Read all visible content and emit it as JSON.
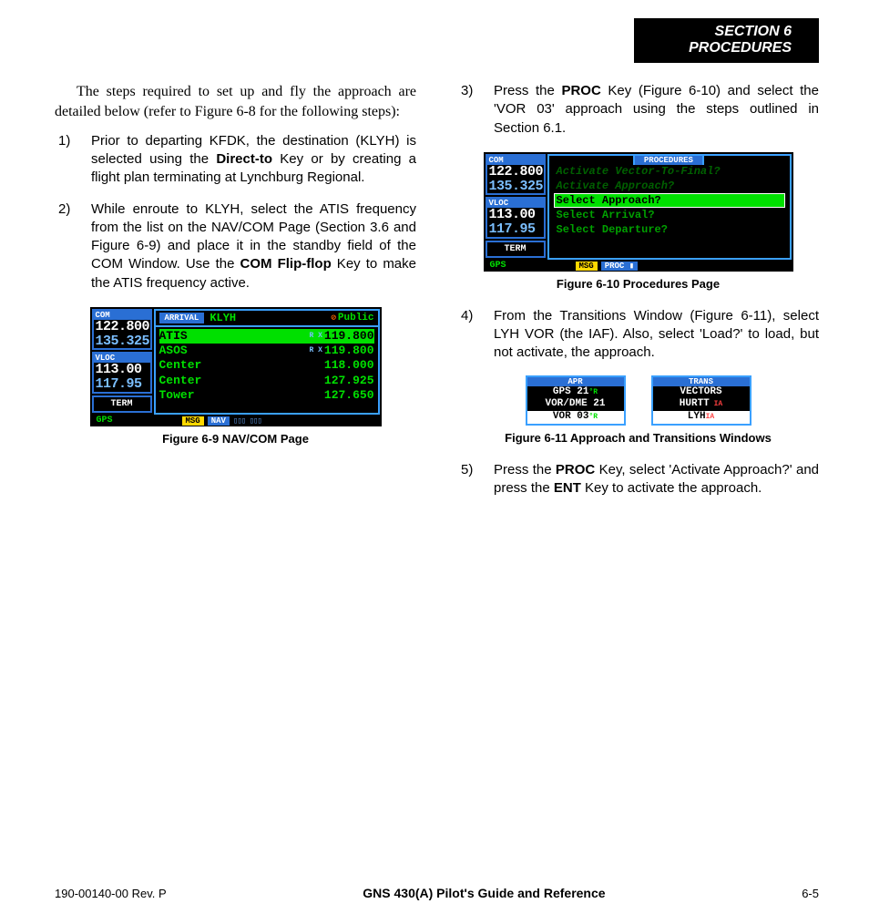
{
  "header": {
    "line1": "SECTION 6",
    "line2": "PROCEDURES"
  },
  "intro": "The steps required to set up and fly the approach are detailed below (refer to Figure 6-8 for the following steps):",
  "steps": {
    "s1": {
      "num": "1)",
      "pre": "Prior to departing KFDK, the destination (KLYH) is selected using the ",
      "bold": "Direct-to",
      "post": " Key or by creating a flight plan terminating at Lynchburg Regional."
    },
    "s2": {
      "num": "2)",
      "pre": "While enroute to KLYH, select the ATIS frequency from the list on the NAV/COM Page (Section 3.6 and Figure 6-9) and place it in the standby field of the COM Window.  Use the ",
      "bold": "COM Flip-flop",
      "post": " Key to make the ATIS frequency active."
    },
    "s3": {
      "num": "3)",
      "pre": "Press the ",
      "bold": "PROC",
      "post": " Key (Figure 6-10) and select the 'VOR 03' approach using the steps outlined in Section 6.1."
    },
    "s4": {
      "num": "4)",
      "text": "From the Transitions Window (Figure 6-11), select LYH VOR (the IAF).  Also, select 'Load?' to load, but not activate, the approach."
    },
    "s5": {
      "num": "5)",
      "pre": "Press the ",
      "bold1": "PROC",
      "mid": " Key, select 'Activate Approach?' and press the ",
      "bold2": "ENT",
      "post": " Key to activate the approach."
    }
  },
  "fig9": {
    "caption": "Figure 6-9  NAV/COM Page",
    "com_label": "COM",
    "com_active": "122.800",
    "com_standby": "135.325",
    "vloc_label": "VLOC",
    "vloc_active": "113.00",
    "vloc_standby": "117.95",
    "side_tag": "TERM",
    "side_tag2": "GPS",
    "hdr_label": "ARRIVAL",
    "hdr_airport": "KLYH",
    "hdr_type": "Public",
    "hdr_icon": "⊘",
    "rows": [
      {
        "name": "ATIS",
        "rx": "R X",
        "freq": "119.800",
        "sel": true
      },
      {
        "name": "ASOS",
        "rx": "R X",
        "freq": "119.800",
        "sel": false
      },
      {
        "name": "Center",
        "rx": "",
        "freq": "118.000",
        "sel": false
      },
      {
        "name": "Center",
        "rx": "",
        "freq": "127.925",
        "sel": false
      },
      {
        "name": "Tower",
        "rx": "",
        "freq": "127.650",
        "sel": false
      }
    ],
    "footer_msg": "MSG",
    "footer_tab": "NAV",
    "footer_boxes": "▯▯▯ ▯▯▯"
  },
  "fig10": {
    "caption": "Figure 6-10  Procedures Page",
    "com_label": "COM",
    "com_active": "122.800",
    "com_standby": "135.325",
    "vloc_label": "VLOC",
    "vloc_active": "113.00",
    "vloc_standby": "117.95",
    "side_tag": "TERM",
    "side_tag2": "GPS",
    "title": "PROCEDURES",
    "items": [
      {
        "text": "Activate Vector-To-Final?",
        "dim": true,
        "sel": false
      },
      {
        "text": "Activate Approach?",
        "dim": true,
        "sel": false
      },
      {
        "text": "Select Approach?",
        "dim": false,
        "sel": true
      },
      {
        "text": "Select Arrival?",
        "dim": false,
        "sel": false
      },
      {
        "text": "Select Departure?",
        "dim": false,
        "sel": false
      }
    ],
    "footer_msg": "MSG",
    "footer_tab": "PROC ▮"
  },
  "fig11": {
    "caption": "Figure 6-11  Approach and Transitions Windows",
    "apr": {
      "title": "APR",
      "rows": [
        {
          "t": "GPS 21",
          "suf": "°R",
          "sel": false
        },
        {
          "t": "VOR/DME 21",
          "suf": "",
          "sel": false
        },
        {
          "t": "VOR 03",
          "suf": "°R",
          "sel": true
        }
      ]
    },
    "trans": {
      "title": "TRANS",
      "rows": [
        {
          "t": "VECTORS",
          "suf": "",
          "sel": false
        },
        {
          "t": "HURTT",
          "suf": " IA",
          "sel": false,
          "red": true
        },
        {
          "t": "LYH",
          "suf": "IA",
          "sel": true,
          "red": true
        }
      ]
    }
  },
  "footer": {
    "left": "190-00140-00  Rev. P",
    "center": "GNS 430(A) Pilot's Guide and Reference",
    "right": "6-5"
  }
}
